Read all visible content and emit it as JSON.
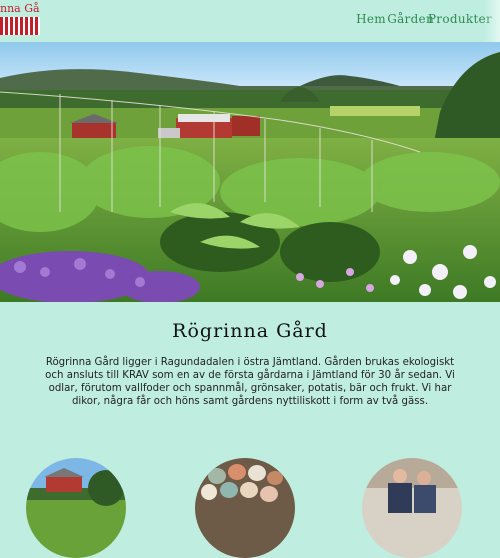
{
  "site": {
    "logo_text": "nna Gård"
  },
  "nav": {
    "items": [
      {
        "label": "Hem"
      },
      {
        "label": "Gården"
      },
      {
        "label": "Produkter"
      }
    ]
  },
  "about": {
    "title": "Rögrinna Gård",
    "body": "Rögrinna Gård ligger i Ragundadalen i östra Jämtland. Gården brukas ekologiskt och ansluts till KRAV som en av de första gårdarna i Jämtland för 30 år sedan. Vi odlar, förutom vallfoder och spannmål, grönsaker, potatis, bär och frukt. Vi har dikor, några får och höns samt gårdens nyttiliskott i form av två gäss."
  },
  "colors": {
    "background": "#bfeee0",
    "nav": "#2f8a52",
    "logo": "#c21f2a"
  },
  "icons": []
}
